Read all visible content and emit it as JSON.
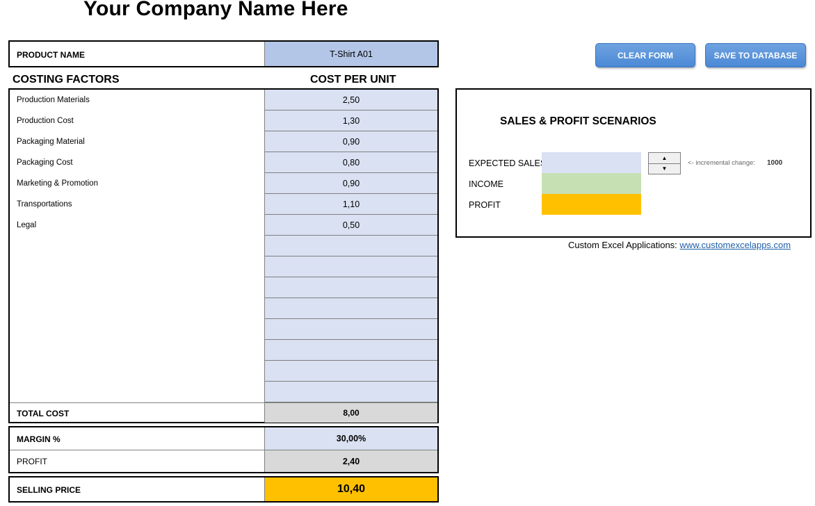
{
  "company_name": "Your Company Name Here",
  "product": {
    "label": "PRODUCT NAME",
    "value": "T-Shirt A01"
  },
  "headers": {
    "factors": "COSTING FACTORS",
    "cost": "COST PER UNIT"
  },
  "costing_rows": [
    {
      "label": "Production Materials",
      "value": "2,50"
    },
    {
      "label": "Production Cost",
      "value": "1,30"
    },
    {
      "label": "Packaging Material",
      "value": "0,90"
    },
    {
      "label": "Packaging Cost",
      "value": "0,80"
    },
    {
      "label": "Marketing & Promotion",
      "value": "0,90"
    },
    {
      "label": "Transportations",
      "value": "1,10"
    },
    {
      "label": "Legal",
      "value": "0,50"
    },
    {
      "label": "",
      "value": ""
    },
    {
      "label": "",
      "value": ""
    },
    {
      "label": "",
      "value": ""
    },
    {
      "label": "",
      "value": ""
    },
    {
      "label": "",
      "value": ""
    },
    {
      "label": "",
      "value": ""
    },
    {
      "label": "",
      "value": ""
    },
    {
      "label": "",
      "value": ""
    }
  ],
  "total": {
    "label": "TOTAL COST",
    "value": "8,00"
  },
  "margin": {
    "label": "MARGIN %",
    "value": "30,00%"
  },
  "profit": {
    "label": "PROFIT",
    "value": "2,40"
  },
  "selling": {
    "label": "SELLING PRICE",
    "value": "10,40"
  },
  "buttons": {
    "clear": "CLEAR FORM",
    "save": "SAVE TO DATABASE"
  },
  "scenarios": {
    "title": "SALES & PROFIT SCENARIOS",
    "expected_label": "EXPECTED SALES",
    "income_label": "INCOME",
    "profit_label": "PROFIT",
    "expected_value": "",
    "income_value": "",
    "profit_value": "",
    "spin_up": "▲",
    "spin_down": "▼",
    "inc_note": "<- incremental change:",
    "inc_value": "1000"
  },
  "footer": {
    "text": "Custom Excel Applications:",
    "link": "www.customexcelapps.com"
  },
  "colors": {
    "input_blue": "#d9e1f2",
    "product_blue": "#b4c6e7",
    "total_gray": "#d9d9d9",
    "selling_orange": "#ffc000",
    "income_green": "#c6e0b4",
    "button_blue": "#5b9bd5"
  }
}
